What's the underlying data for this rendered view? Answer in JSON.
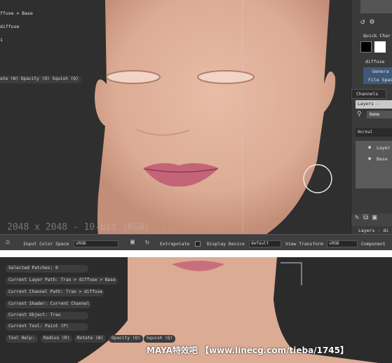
{
  "top": {
    "breadcrumb": "ffuse > Base",
    "channel": "diffuse",
    "one": "1",
    "tool_help": "ate (W)  Opacity (O)  Squish (Q)",
    "viewport_overlay": "2048 x 2048 - 10-bit (RGB) ...",
    "panel": {
      "quick_label": "Quick Char",
      "diffuse": "diffuse",
      "general": "Genera",
      "file_space": "File Spac",
      "channels_tab": "Channels",
      "layers_title": "Layers - diffu",
      "name_col": "Name",
      "blend_mode": "Normal",
      "layer1": "Layer",
      "layer2": "Base",
      "layers_footer": "Layers - di"
    },
    "status": {
      "input_color_label": "Input Color Space",
      "input_color_value": "sRGB",
      "extrapolate": "Extrapolate",
      "display_device_label": "Display Device",
      "display_device_value": "default",
      "view_transform_label": "View Transform",
      "view_transform_value": "sRGB",
      "component_label": "Component"
    }
  },
  "bottom": {
    "selected_patches": "Selected Patches: 0",
    "layer_path": "Current Layer Path: Trax > diffuse > Base",
    "channel_path": "Current Channel Path: Trax > diffuse",
    "shader": "Current Shader: Current Channel",
    "object": "Current Object: Trax",
    "tool": "Current Tool: Paint (P)",
    "help_label": "Tool Help:",
    "radius": "Radius (R)",
    "rotate": "Rotate (W)",
    "opacity": "Opacity (O)",
    "squish": "Squish (Q)"
  },
  "watermark": "MAYA特效吧 【www.linecg.com/tieba/1745】",
  "colors": {
    "skin": "#e3b39d",
    "lips": "#c46478",
    "bg": "#2e2e2e"
  }
}
